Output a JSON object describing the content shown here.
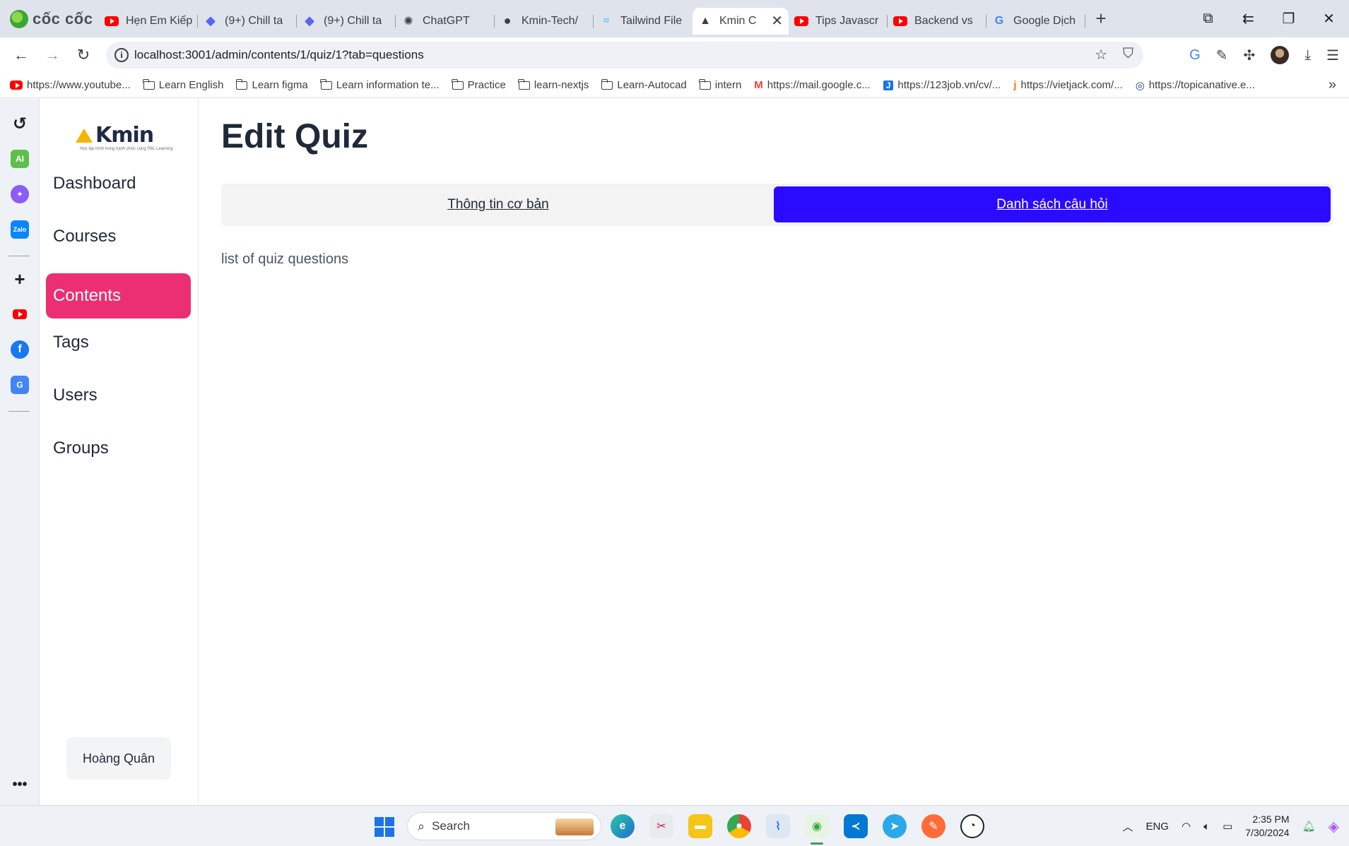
{
  "browser": {
    "brand": "cốc cốc",
    "tabs": [
      {
        "label": "Hẹn Em Kiếp",
        "icon": "youtube-icon"
      },
      {
        "label": "(9+) Chill ta",
        "icon": "discord-icon"
      },
      {
        "label": "(9+) Chill ta",
        "icon": "discord-icon"
      },
      {
        "label": "ChatGPT",
        "icon": "openai-icon"
      },
      {
        "label": "Kmin-Tech/",
        "icon": "github-icon"
      },
      {
        "label": "Tailwind File",
        "icon": "tailwind-icon"
      },
      {
        "label": "Kmin C",
        "icon": "triangle-icon",
        "active": true
      },
      {
        "label": "Tips Javascr",
        "icon": "youtube-icon"
      },
      {
        "label": "Backend vs",
        "icon": "youtube-icon"
      },
      {
        "label": "Google Dịch",
        "icon": "google-translate-icon"
      }
    ],
    "url": "localhost:3001/admin/contents/1/quiz/1?tab=questions",
    "bookmarks": [
      {
        "label": "https://www.youtube...",
        "icon": "youtube-icon"
      },
      {
        "label": "Learn English",
        "icon": "folder-icon"
      },
      {
        "label": "Learn figma",
        "icon": "folder-icon"
      },
      {
        "label": "Learn information te...",
        "icon": "folder-icon"
      },
      {
        "label": "Practice",
        "icon": "folder-icon"
      },
      {
        "label": "learn-nextjs",
        "icon": "folder-icon"
      },
      {
        "label": "Learn-Autocad",
        "icon": "folder-icon"
      },
      {
        "label": "intern",
        "icon": "folder-icon"
      },
      {
        "label": "https://mail.google.c...",
        "icon": "gmail-icon"
      },
      {
        "label": "https://123job.vn/cv/...",
        "icon": "job-icon"
      },
      {
        "label": "https://vietjack.com/...",
        "icon": "vietjack-icon"
      },
      {
        "label": "https://topicanative.e...",
        "icon": "topica-icon"
      }
    ]
  },
  "sidebar": {
    "logo_text": "Kmin",
    "logo_tagline": "Học lập trình trong hạnh phúc cùng PBL Learning",
    "items": [
      {
        "label": "Dashboard"
      },
      {
        "label": "Courses"
      },
      {
        "label": "Contents",
        "active": true
      },
      {
        "label": "Tags"
      },
      {
        "label": "Users"
      },
      {
        "label": "Groups"
      }
    ],
    "user_name": "Hoàng Quân"
  },
  "main": {
    "title": "Edit Quiz",
    "tabs": [
      {
        "label": "Thông tin cơ bản"
      },
      {
        "label": "Danh sách câu hỏi",
        "active": true
      }
    ],
    "content_text": "list of quiz questions"
  },
  "taskbar": {
    "search_placeholder": "Search",
    "language": "ENG",
    "time": "2:35 PM",
    "date": "7/30/2024"
  },
  "colors": {
    "active_menu": "#ec2f72",
    "active_tab": "#2b0bff"
  }
}
